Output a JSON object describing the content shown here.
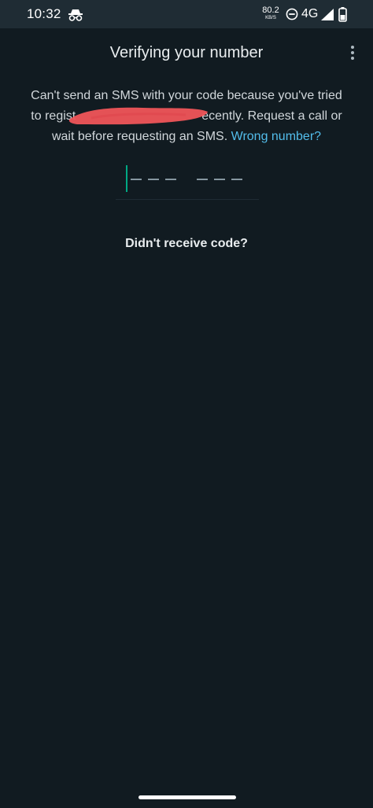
{
  "status_bar": {
    "time": "10:32",
    "net_speed_value": "80.2",
    "net_speed_unit": "KB/S",
    "network_type": "4G",
    "icons": [
      "incognito-icon",
      "do-not-disturb-icon",
      "signal-icon",
      "battery-icon"
    ]
  },
  "header": {
    "title": "Verifying your number",
    "menu_icon": "more-vert-icon"
  },
  "message": {
    "text_line1": "Can't send an SMS with your code because you've tried",
    "text_line2_start": "to regist",
    "text_line2_end": "ecently. Request a call or",
    "text_line3": "wait before requesting an SMS.",
    "link": "Wrong number?"
  },
  "code_input": {
    "placeholder": "--- ---",
    "digits": 6
  },
  "resend": {
    "label": "Didn't receive code?"
  },
  "colors": {
    "background": "#111b21",
    "status_bar": "#1f2c34",
    "accent": "#00a884",
    "link": "#53bdeb",
    "redaction": "#f0555a"
  }
}
